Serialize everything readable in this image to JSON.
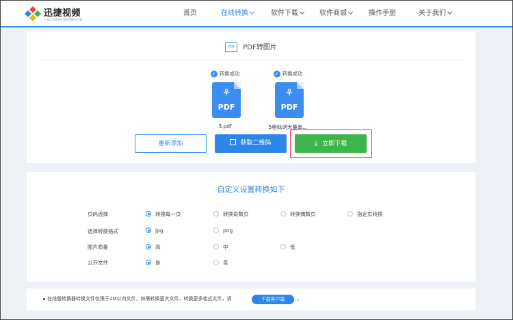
{
  "header": {
    "brand": "迅捷视频",
    "slogan": "一站式音视频在线处理解决方案",
    "nav": [
      {
        "label": "首页",
        "dropdown": false,
        "active": false
      },
      {
        "label": "在线转换",
        "dropdown": true,
        "active": true
      },
      {
        "label": "软件下载",
        "dropdown": true,
        "active": false
      },
      {
        "label": "软件商城",
        "dropdown": true,
        "active": false
      },
      {
        "label": "操作手册",
        "dropdown": false,
        "active": false
      },
      {
        "label": "关于我们",
        "dropdown": true,
        "active": false
      }
    ]
  },
  "convert": {
    "icon_text": "PDF",
    "title": "PDF转图片",
    "files": [
      {
        "status": "转换成功",
        "icon_label": "PDF",
        "name": "3.pdf"
      },
      {
        "status": "转换成功",
        "icon_label": "PDF",
        "name": "5相似词大量串..."
      }
    ],
    "buttons": {
      "readd": "重新添加",
      "qrcode": "获取二维码",
      "download": "立即下载"
    }
  },
  "settings": {
    "title": "自定义设置转换如下",
    "rows": [
      {
        "label": "页码选择",
        "options": [
          {
            "text": "转换每一页",
            "checked": true
          },
          {
            "text": "转换奇数页",
            "checked": false
          },
          {
            "text": "转换偶数页",
            "checked": false
          },
          {
            "text": "指定页转换",
            "checked": false
          }
        ]
      },
      {
        "label": "选择转换格式",
        "options": [
          {
            "text": "jpg",
            "checked": true
          },
          {
            "text": "png",
            "checked": false
          }
        ]
      },
      {
        "label": "图片质量",
        "options": [
          {
            "text": "高",
            "checked": true
          },
          {
            "text": "中",
            "checked": false
          },
          {
            "text": "低",
            "checked": false
          }
        ]
      },
      {
        "label": "公开文件",
        "options": [
          {
            "text": "是",
            "checked": true
          },
          {
            "text": "否",
            "checked": false
          }
        ]
      }
    ]
  },
  "notice": {
    "text": "在线版转换器转换文件仅限于2M以内文件，如需转换更大文件、转换更多格式文件，请",
    "button": "下载客户端",
    "end": "。"
  },
  "colors": {
    "primary": "#2e86e8",
    "success": "#3cb54a",
    "highlight": "#e03a3a"
  }
}
